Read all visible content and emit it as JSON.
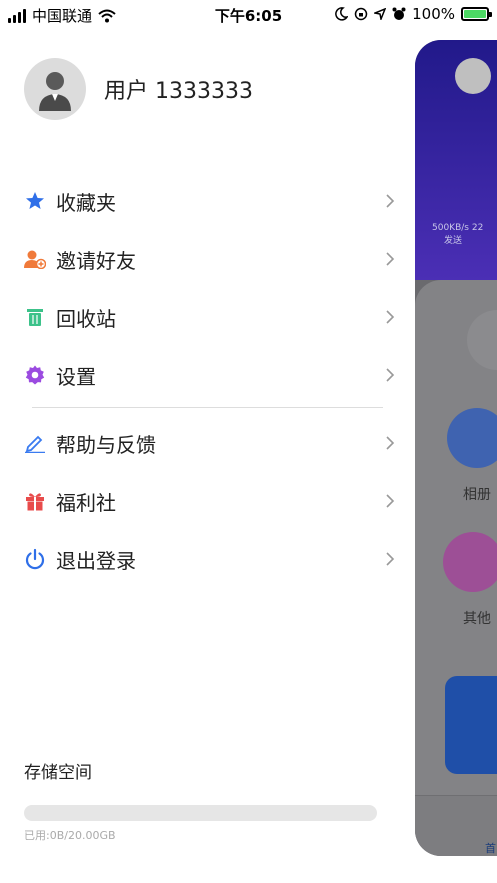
{
  "status_bar": {
    "carrier": "中国联通",
    "time": "下午6:05",
    "battery_percent": "100%"
  },
  "profile": {
    "username": "用户 1333333"
  },
  "menu": {
    "items": [
      {
        "label": "收藏夹",
        "icon": "star-icon",
        "color": "#2f6fe8"
      },
      {
        "label": "邀请好友",
        "icon": "add-user-icon",
        "color": "#f07a3a"
      },
      {
        "label": "回收站",
        "icon": "trash-icon",
        "color": "#3cc28a"
      },
      {
        "label": "设置",
        "icon": "gear-icon",
        "color": "#9b4be0"
      }
    ],
    "items2": [
      {
        "label": "帮助与反馈",
        "icon": "edit-icon",
        "color": "#3a7bf0"
      },
      {
        "label": "福利社",
        "icon": "gift-icon",
        "color": "#e84b4b"
      },
      {
        "label": "退出登录",
        "icon": "power-icon",
        "color": "#2f6fe8"
      }
    ]
  },
  "storage": {
    "title": "存储空间",
    "used_text": "已用:0B/20.00GB",
    "used_fraction": 0
  },
  "background_panel": {
    "speed_value": "500KB/s",
    "speed_value2": "22",
    "speed_label": "发送",
    "tile1_label": "相册",
    "tile2_label": "其他",
    "tab_label": "首"
  }
}
